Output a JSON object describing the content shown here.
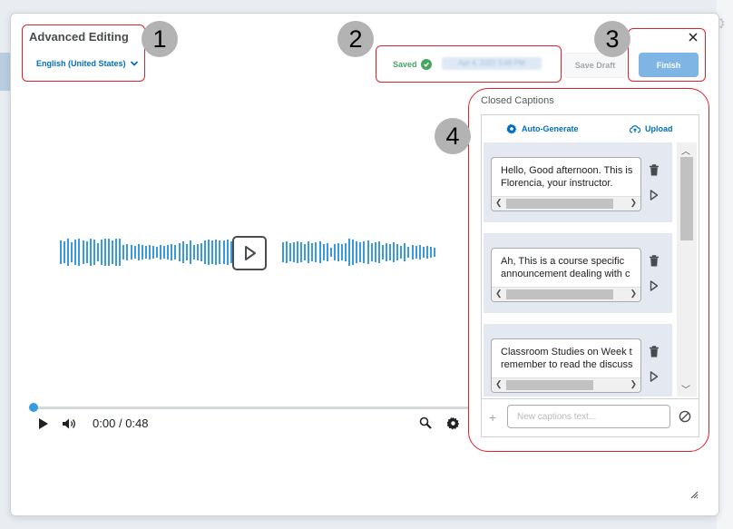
{
  "dialog": {
    "title": "Advanced Editing",
    "language": "English (United States)",
    "saved_label": "Saved",
    "saved_timestamp": "Apr 4, 2022 3:48 PM",
    "save_draft_label": "Save Draft",
    "finish_label": "Finish"
  },
  "annotations": [
    "1",
    "2",
    "3",
    "4"
  ],
  "player": {
    "time_current": "0:00",
    "time_separator": "/",
    "time_total": "0:48",
    "progress": 0
  },
  "captions": {
    "title": "Closed Captions",
    "auto_generate_label": "Auto-Generate",
    "upload_label": "Upload",
    "cues": [
      {
        "line1": "Hello, Good afternoon. This is",
        "line2": "Florencia, your instructor."
      },
      {
        "line1": "Ah, This is a course specific",
        "line2": "announcement dealing with c"
      },
      {
        "line1": "Classroom Studies on Week t",
        "line2": "remember to read the discuss"
      }
    ],
    "new_caption_placeholder": "New captions text..."
  },
  "colors": {
    "accent": "#006fbf",
    "waveform": "#3a9ae0",
    "saved_green": "#46a661",
    "highlight_red": "#d9232e",
    "finish_button": "#7fb5e4"
  }
}
